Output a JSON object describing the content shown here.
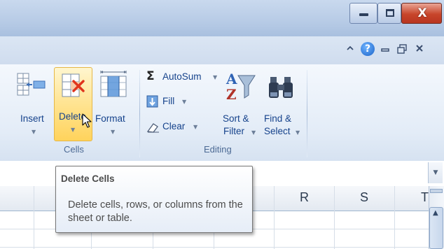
{
  "window": {
    "minimize_icon": "minimize-icon",
    "maximize_icon": "maximize-icon",
    "close_icon": "close-icon",
    "close_glyph": "X",
    "accent_close": "#c8452b"
  },
  "ribbon_bar": {
    "help_glyph": "?",
    "icons": [
      "ribbon-minimize-icon",
      "help-icon",
      "workbook-minimize-icon",
      "workbook-restore-icon",
      "workbook-close-icon"
    ]
  },
  "cells_group": {
    "label": "Cells",
    "insert_label": "Insert",
    "delete_label": "Delete",
    "format_label": "Format"
  },
  "editing_group": {
    "label": "Editing",
    "autosum_symbol": "Σ",
    "autosum_label": "AutoSum",
    "fill_label": "Fill",
    "clear_label": "Clear",
    "sort_line1": "Sort &",
    "sort_line2": "Filter",
    "find_line1": "Find &",
    "find_line2": "Select"
  },
  "tooltip": {
    "title": "Delete Cells",
    "body": "Delete cells, rows, or columns from the sheet or table."
  },
  "sheet": {
    "columns": [
      "R",
      "S",
      "T"
    ]
  },
  "colors": {
    "highlight": "#ffd35c",
    "label_blue": "#15428b"
  }
}
